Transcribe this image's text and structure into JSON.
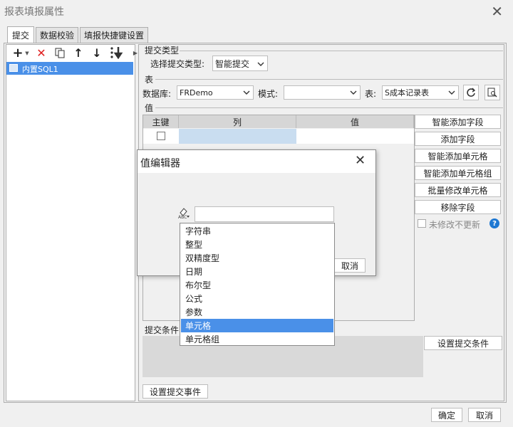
{
  "window": {
    "title": "报表填报属性"
  },
  "tabs": [
    {
      "label": "提交"
    },
    {
      "label": "数据校验"
    },
    {
      "label": "填报快捷键设置"
    }
  ],
  "tree": {
    "items": [
      {
        "label": "内置SQL1"
      }
    ]
  },
  "submit_type": {
    "section": "提交类型",
    "label": "选择提交类型:",
    "value": "智能提交"
  },
  "table_section": {
    "section": "表",
    "db_label": "数据库:",
    "db_value": "FRDemo",
    "schema_label": "模式:",
    "schema_value": "",
    "table_label": "表:",
    "table_value": "S成本记录表"
  },
  "value_section": {
    "section": "值",
    "columns": [
      "主键",
      "列",
      "值"
    ]
  },
  "side_buttons": {
    "smart_add_field": "智能添加字段",
    "add_field": "添加字段",
    "smart_add_cell": "智能添加单元格",
    "smart_add_cell_group": "智能添加单元格组",
    "batch_modify_cell": "批量修改单元格",
    "remove_field": "移除字段",
    "no_update_label": "未修改不更新"
  },
  "submit_condition": {
    "section": "提交条件",
    "button": "设置提交条件"
  },
  "submit_event_button": "设置提交事件",
  "footer": {
    "ok": "确定",
    "cancel": "取消"
  },
  "value_editor": {
    "title": "值编辑器",
    "input_value": "",
    "cancel": "取消",
    "type_options": [
      "字符串",
      "整型",
      "双精度型",
      "日期",
      "布尔型",
      "公式",
      "参数",
      "单元格",
      "单元格组"
    ],
    "selected_type": "单元格"
  },
  "colors": {
    "accent": "#4a90e8",
    "selected_row": "#c9ddf0"
  }
}
